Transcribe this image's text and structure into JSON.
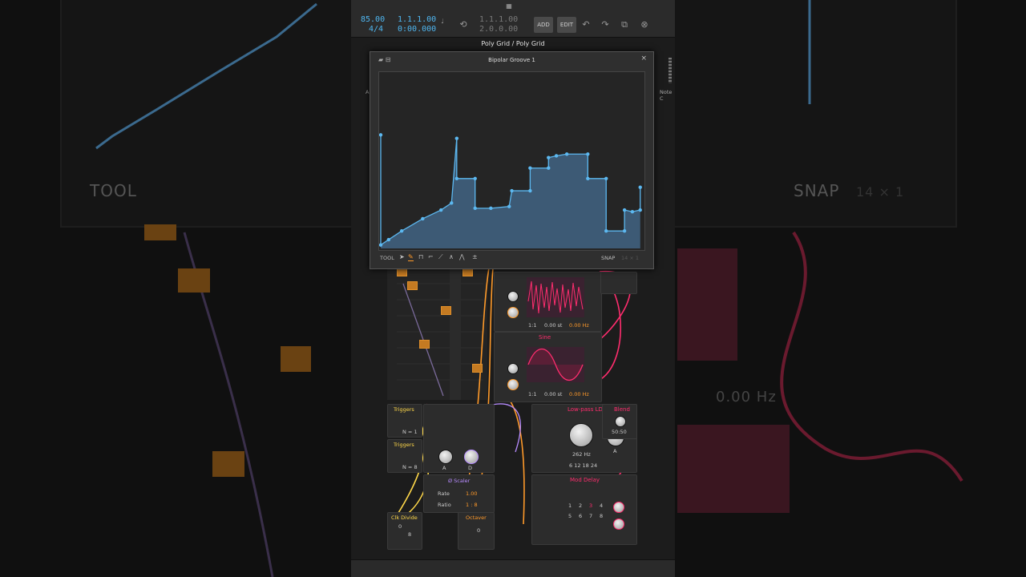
{
  "transport": {
    "tempo": "85.00",
    "time_sig": "4/4",
    "position_bars": "1.1.1.00",
    "position_time": "0:00.000",
    "loop_start": "1.1.1.00",
    "loop_length": "2.0.0.00",
    "add_label": "ADD",
    "edit_label": "EDIT"
  },
  "breadcrumb": "Poly Grid / Poly Grid",
  "popup": {
    "title": "Bipolar Groove 1",
    "close": "×",
    "tool_label": "TOOL",
    "snap_label": "SNAP",
    "snap_value": "14 × 1",
    "curve_points": [
      [
        0.0,
        0.65
      ],
      [
        0.0,
        0.02
      ],
      [
        0.03,
        0.05
      ],
      [
        0.08,
        0.1
      ],
      [
        0.16,
        0.17
      ],
      [
        0.23,
        0.22
      ],
      [
        0.27,
        0.26
      ],
      [
        0.29,
        0.63
      ],
      [
        0.29,
        0.4
      ],
      [
        0.36,
        0.4
      ],
      [
        0.36,
        0.23
      ],
      [
        0.42,
        0.23
      ],
      [
        0.49,
        0.24
      ],
      [
        0.5,
        0.33
      ],
      [
        0.57,
        0.33
      ],
      [
        0.57,
        0.46
      ],
      [
        0.64,
        0.46
      ],
      [
        0.64,
        0.52
      ],
      [
        0.67,
        0.53
      ],
      [
        0.71,
        0.54
      ],
      [
        0.79,
        0.54
      ],
      [
        0.79,
        0.4
      ],
      [
        0.86,
        0.4
      ],
      [
        0.86,
        0.1
      ],
      [
        0.93,
        0.1
      ],
      [
        0.93,
        0.22
      ],
      [
        0.96,
        0.21
      ],
      [
        0.99,
        0.22
      ],
      [
        0.99,
        0.35
      ]
    ],
    "fill_color": "#3d5a75",
    "line_color": "#5cb8f0"
  },
  "background": {
    "tool_label": "TOOL",
    "snap_label": "SNAP",
    "snap_value": "14 × 1",
    "hz_label": "0.00 Hz"
  },
  "side_labels": {
    "left_cut": "A",
    "note_cut": "Note C"
  },
  "modules": {
    "osc1": {
      "ratio": "1:1",
      "st": "0.00 st",
      "hz": "0.00 Hz"
    },
    "osc2": {
      "title": "Sine",
      "ratio": "1:1",
      "st": "0.00 st",
      "hz": "0.00 Hz"
    },
    "triggers1": {
      "title": "Triggers",
      "n": "N = 1"
    },
    "triggers2": {
      "title": "Triggers",
      "n": "N = 8"
    },
    "env": {
      "a": "A",
      "d": "D"
    },
    "lfo": {
      "title": "Low-pass LD",
      "freq": "262 Hz",
      "a_label": "A",
      "slopes": "6 12 18 24"
    },
    "blend": {
      "title": "Blend",
      "value": "50:50"
    },
    "phase_scaler": {
      "title": "Ø Scaler",
      "rate_label": "Rate",
      "rate_value": "1.00",
      "ratio_label": "Ratio",
      "ratio_value": "1 : 8"
    },
    "clk_divide": {
      "title": "Clk Divide",
      "top": "0",
      "bottom": "8"
    },
    "octaver": {
      "title": "Octaver",
      "value": "0"
    },
    "mod_delay": {
      "title": "Mod Delay",
      "grid_row1": [
        "1",
        "2",
        "3",
        "4"
      ],
      "grid_row2": [
        "5",
        "6",
        "7",
        "8"
      ]
    }
  }
}
